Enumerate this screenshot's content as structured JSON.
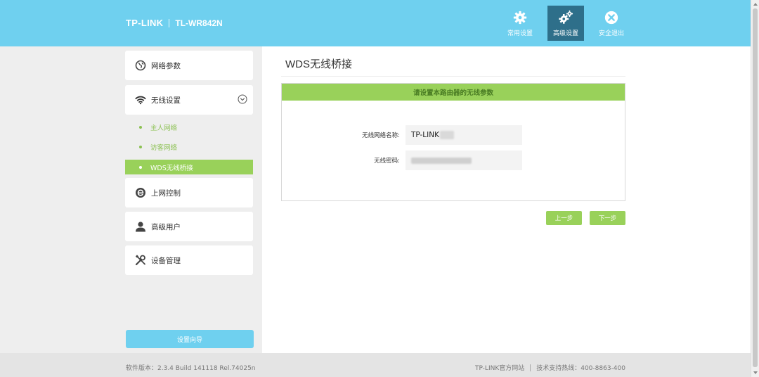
{
  "header": {
    "brand": "TP-LINK",
    "model": "TL-WR842N",
    "nav": [
      {
        "label": "常用设置",
        "icon": "gear-icon"
      },
      {
        "label": "高级设置",
        "icon": "gears-icon",
        "active": true
      },
      {
        "label": "安全退出",
        "icon": "close-circle-icon"
      }
    ]
  },
  "sidebar": {
    "items": [
      {
        "label": "网络参数",
        "icon": "globe-icon"
      },
      {
        "label": "无线设置",
        "icon": "wifi-icon",
        "expanded": true
      },
      {
        "label": "上网控制",
        "icon": "ie-icon"
      },
      {
        "label": "高级用户",
        "icon": "user-icon"
      },
      {
        "label": "设备管理",
        "icon": "tools-icon"
      }
    ],
    "sub_items": [
      {
        "label": "主人网络"
      },
      {
        "label": "访客网络"
      },
      {
        "label": "WDS无线桥接",
        "active": true
      }
    ],
    "wizard_label": "设置向导"
  },
  "main": {
    "title": "WDS无线桥接",
    "panel_header": "请设置本路由器的无线参数",
    "ssid_label": "无线网络名称:",
    "ssid_value": "TP-LINK",
    "password_label": "无线密码:",
    "prev_label": "上一步",
    "next_label": "下一步"
  },
  "footer": {
    "version": "软件版本：2.3.4 Build 141118 Rel.74025n",
    "site": "TP-LINK官方网站",
    "hotline": "技术支持热线：400-8863-400"
  },
  "colors": {
    "header_bg": "#6fd0ef",
    "active_nav": "#2e6f8a",
    "green": "#99d15a",
    "sidebar_bg": "#eeeeee"
  }
}
